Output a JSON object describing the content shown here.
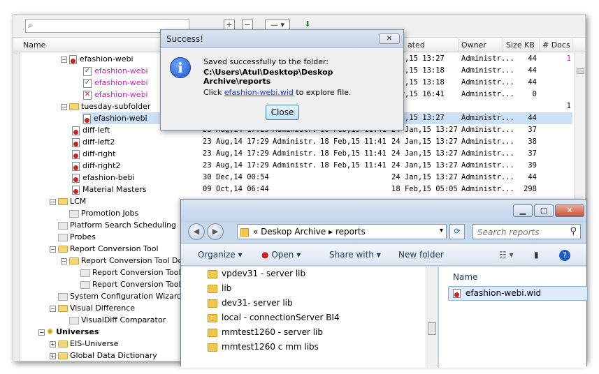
{
  "toolbar": {
    "search_placeholder": ""
  },
  "columns": [
    {
      "label": "Name"
    },
    {
      "label": "ated"
    },
    {
      "label": "Owner"
    },
    {
      "label": "Size KB"
    },
    {
      "label": "# Docs"
    }
  ],
  "tree_rows": [
    {
      "name": "efashion-webi",
      "c1": "",
      "c2": "",
      "c3": "",
      "c4": "Jan,15 13:27",
      "owner": "Administr...",
      "size": "44",
      "docs": "1"
    },
    {
      "name": "efashion-webi",
      "c1": "",
      "c2": "",
      "c3": "",
      "c4": "Jan,15 13:18",
      "owner": "Administr...",
      "size": "44",
      "docs": ""
    },
    {
      "name": "efashion-webi",
      "c1": "",
      "c2": "",
      "c3": "",
      "c4": "Jan,15 13:18",
      "owner": "Administr...",
      "size": "44",
      "docs": ""
    },
    {
      "name": "efashion-webi",
      "c1": "",
      "c2": "",
      "c3": "",
      "c4": "Mar,15 16:41",
      "owner": "Administr...",
      "size": "0",
      "docs": ""
    },
    {
      "name": "tuesday-subfolder",
      "c1": "",
      "c2": "",
      "c3": "",
      "c4": "",
      "owner": "",
      "size": "",
      "docs": "1"
    },
    {
      "name": "efashion-webi",
      "c1": "",
      "c2": "",
      "c3": "",
      "c4": "Jan,15 13:27",
      "owner": "Administr...",
      "size": "44",
      "docs": ""
    },
    {
      "name": "diff-left",
      "c1": "23 Aug,14 17:29",
      "c2": "Administr...",
      "c3": "18 Feb,15 11:41",
      "c4": "24 Jan,15 13:27",
      "owner": "Administr...",
      "size": "37",
      "docs": ""
    },
    {
      "name": "diff-left2",
      "c1": "23 Aug,14 17:29",
      "c2": "Administr...",
      "c3": "18 Feb,15 11:41",
      "c4": "24 Jan,15 13:27",
      "owner": "Administr...",
      "size": "38",
      "docs": ""
    },
    {
      "name": "diff-right",
      "c1": "23 Aug,14 17:29",
      "c2": "Administr...",
      "c3": "18 Feb,15 11:41",
      "c4": "24 Jan,15 13:27",
      "owner": "Administr...",
      "size": "37",
      "docs": ""
    },
    {
      "name": "diff-right2",
      "c1": "23 Aug,14 17:29",
      "c2": "Administr...",
      "c3": "18 Feb,15 11:41",
      "c4": "24 Jan,15 13:27",
      "owner": "Administr...",
      "size": "39",
      "docs": ""
    },
    {
      "name": "efashion-bebi",
      "c1": "30 Dec,14 00:54",
      "c2": "",
      "c3": "",
      "c4": "24 Jan,15 13:27",
      "owner": "Administr...",
      "size": "44",
      "docs": ""
    },
    {
      "name": "Material Masters",
      "c1": "09 Oct,14 06:44",
      "c2": "",
      "c3": "",
      "c4": "18 Feb,15 05:05",
      "owner": "Administr...",
      "size": "298",
      "docs": ""
    },
    {
      "name": "LCM"
    },
    {
      "name": "Promotion Jobs"
    },
    {
      "name": "Platform Search Scheduling"
    },
    {
      "name": "Probes"
    },
    {
      "name": "Report Conversion Tool"
    },
    {
      "name": "Report Conversion Tool Docu"
    },
    {
      "name": "Report Conversion Tool A"
    },
    {
      "name": "Report Conversion Tool T"
    },
    {
      "name": "System Configuration Wizard"
    },
    {
      "name": "Visual Difference"
    },
    {
      "name": "VisualDiff Comparator"
    },
    {
      "name": "Universes"
    },
    {
      "name": "EIS-Universe"
    },
    {
      "name": "Global Data Dictionary"
    }
  ],
  "dialog": {
    "title": "Success!",
    "close_x": "✕",
    "line1": "Saved successfully to the folder:",
    "path": "C:\\Users\\Atul\\Desktop\\Deskop Archive\\reports",
    "click_prefix": "Click ",
    "link": "efashion-webi.wid",
    "click_suffix": " to explore file.",
    "close_button": "Close"
  },
  "explorer": {
    "breadcrumb_prefix": "«",
    "crumb1": "Deskop Archive",
    "crumb2": "reports",
    "search_placeholder": "Search reports",
    "commands": {
      "organize": "Organize",
      "open": "Open",
      "share": "Share with",
      "new_folder": "New folder"
    },
    "folders": [
      "vpdev31 - server lib",
      "lib",
      "dev31- server lib",
      "local - connectionServer BI4",
      "mmtest1260 - server lib",
      "mmtest1260 c mm libs"
    ],
    "column_name": "Name",
    "file_name": "efashion-webi.wid"
  }
}
